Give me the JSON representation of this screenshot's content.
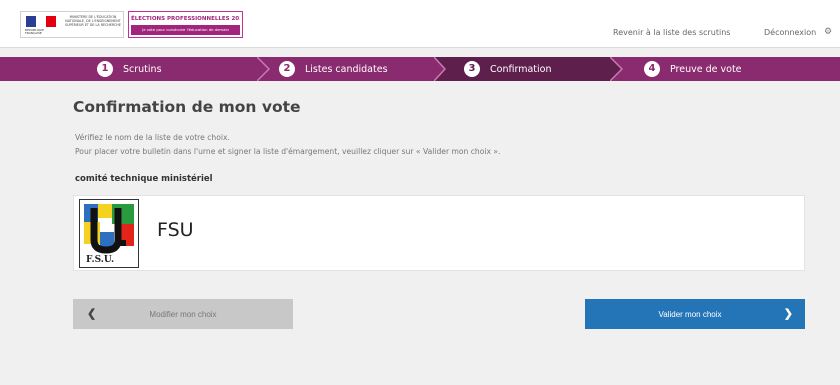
{
  "header": {
    "logo_rf_text": "RÉPUBLIQUE FRANÇAISE",
    "ministry_text": "MINISTÈRE DE L'ÉDUCATION NATIONALE, DE L'ENSEIGNEMENT SUPÉRIEUR ET DE LA RECHERCHE",
    "elections_title": "ÉLECTIONS PROFESSIONNELLES 2014",
    "elections_subtitle": "Je vote pour construire l'éducation de demain",
    "back_link": "Revenir à la liste des scrutins",
    "logout_link": "Déconnexion",
    "settings_icon": "gear-icon"
  },
  "steps": [
    {
      "num": "1",
      "label": "Scrutins",
      "active": false
    },
    {
      "num": "2",
      "label": "Listes candidates",
      "active": false
    },
    {
      "num": "3",
      "label": "Confirmation",
      "active": true
    },
    {
      "num": "4",
      "label": "Preuve de vote",
      "active": false
    }
  ],
  "main": {
    "title": "Confirmation de mon vote",
    "instruction_1": "Vérifiez le nom de la liste de votre choix.",
    "instruction_2": "Pour placer votre bulletin dans l'urne et signer la liste d'émargement, veuillez cliquer sur « Valider mon choix ».",
    "section_label": "comité technique ministériel",
    "choice": {
      "name": "FSU",
      "logo_caption": "F.S.U."
    }
  },
  "buttons": {
    "modify_label": "Modifier mon choix",
    "validate_label": "Valider mon choix"
  },
  "colors": {
    "steps_bg": "#8b2b6f",
    "steps_active": "#5f1f4d",
    "validate_btn": "#2475b8",
    "modify_btn": "#c8c8c8"
  }
}
